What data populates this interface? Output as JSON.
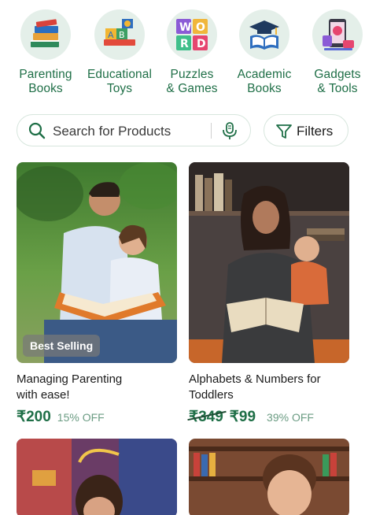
{
  "categories": [
    {
      "line1": "Parenting",
      "line2": "Books",
      "icon": "books-stack-icon"
    },
    {
      "line1": "Educational",
      "line2": "Toys",
      "icon": "abc-blocks-icon"
    },
    {
      "line1": "Puzzles",
      "line2": "& Games",
      "icon": "word-puzzle-icon"
    },
    {
      "line1": "Academic",
      "line2": "Books",
      "icon": "graduation-book-icon"
    },
    {
      "line1": "Gadgets",
      "line2": "& Tools",
      "icon": "tablet-gadget-icon"
    }
  ],
  "search": {
    "placeholder": "Search for Products"
  },
  "filters": {
    "label": "Filters"
  },
  "products": [
    {
      "title_line1": "Managing Parenting",
      "title_line2": "with ease!",
      "price": "₹200",
      "mrp": "",
      "off": "15% OFF",
      "badge": "Best Selling"
    },
    {
      "title_line1": "Alphabets & Numbers for",
      "title_line2": "Toddlers",
      "price": "₹99",
      "mrp": "₹349",
      "off": "39% OFF",
      "badge": ""
    }
  ],
  "colors": {
    "accent": "#1f6f47",
    "circle_bg": "#e4efe9",
    "off_text": "#6b9c83"
  }
}
